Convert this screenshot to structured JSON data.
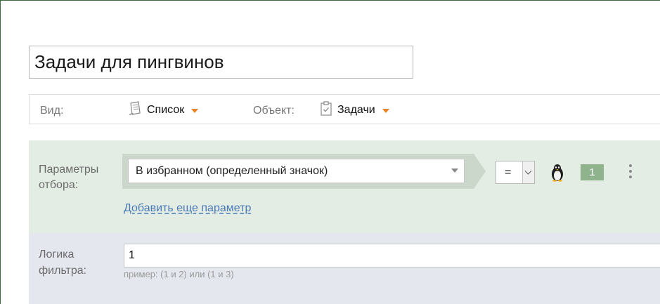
{
  "report": {
    "title_value": "Задачи для пингвинов"
  },
  "view_bar": {
    "view_label": "Вид:",
    "view_value": "Список",
    "object_label": "Объект:",
    "object_value": "Задачи",
    "accent_color": "#e8822b"
  },
  "filter": {
    "label": "Параметры отбора:",
    "param_value": "В избранном (определенный значок)",
    "operator_value": "=",
    "icon": "penguin-icon",
    "badge": "1",
    "add_param_link": "Добавить еще параметр"
  },
  "logic": {
    "label": "Логика фильтра:",
    "input_value": "1",
    "hint": "пример: (1 и 2) или (1 и 3)"
  }
}
